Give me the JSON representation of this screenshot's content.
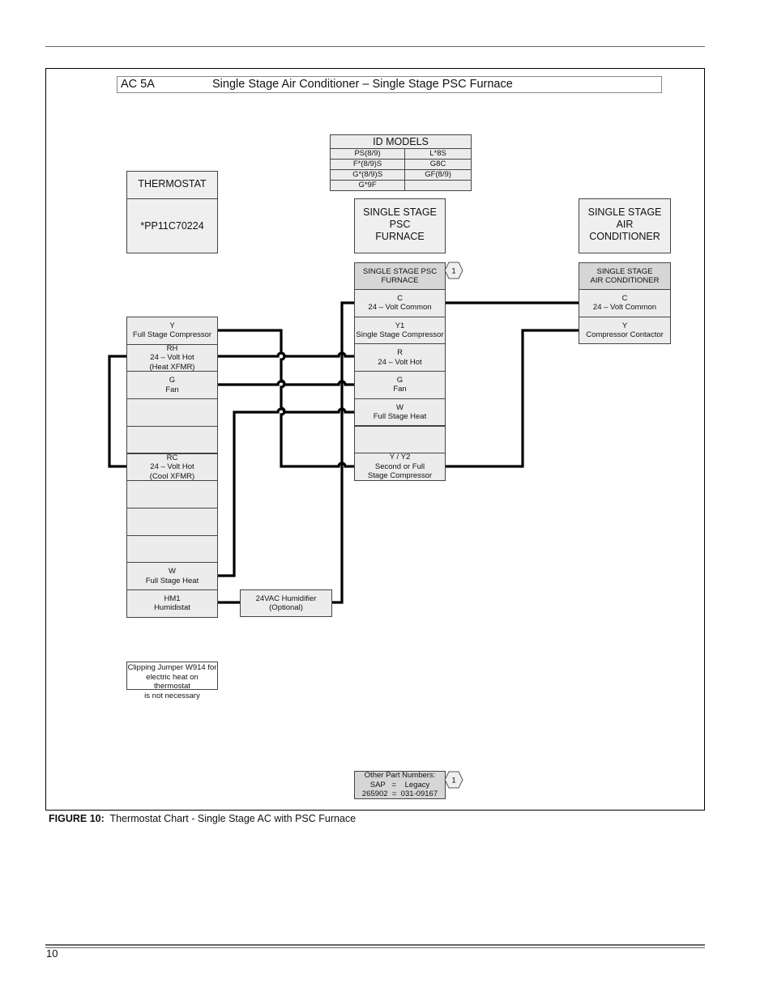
{
  "page": {
    "page_number": "10",
    "caption_label": "FIGURE 10:",
    "caption_text": "Thermostat Chart - Single Stage AC with PSC Furnace"
  },
  "diagram": {
    "code": "AC 5A",
    "title": "Single Stage Air Conditioner – Single Stage PSC Furnace",
    "id_models": {
      "header": "ID MODELS",
      "rows": [
        [
          "PS(8/9)",
          "L*8S"
        ],
        [
          "F*(8/9)S",
          "G8C"
        ],
        [
          "G*(8/9)S",
          "GF(8/9)"
        ],
        [
          "G*9F",
          ""
        ]
      ]
    },
    "thermostat": {
      "header": "THERMOSTAT",
      "model": "*PP11C70224",
      "terminals": [
        {
          "id": "Y",
          "lines": [
            "Y",
            "Full Stage Compressor"
          ]
        },
        {
          "id": "RH",
          "lines": [
            "RH",
            "24 – Volt Hot",
            "(Heat XFMR)"
          ]
        },
        {
          "id": "G",
          "lines": [
            "G",
            "Fan"
          ]
        },
        {
          "id": "blank1",
          "lines": []
        },
        {
          "id": "blank2",
          "lines": []
        },
        {
          "id": "RC",
          "lines": [
            "RC",
            "24 – Volt Hot",
            "(Cool XFMR)"
          ]
        },
        {
          "id": "blank3",
          "lines": []
        },
        {
          "id": "blank4",
          "lines": []
        },
        {
          "id": "blank5",
          "lines": []
        },
        {
          "id": "W",
          "lines": [
            "W",
            "Full Stage Heat"
          ]
        },
        {
          "id": "HM1",
          "lines": [
            "HM1",
            "Humidistat"
          ]
        }
      ]
    },
    "furnace": {
      "title_lines": [
        "SINGLE STAGE",
        "PSC",
        "FURNACE"
      ],
      "header_lines": [
        "SINGLE STAGE PSC",
        "FURNACE"
      ],
      "badge": "1",
      "terminals": [
        {
          "id": "C",
          "lines": [
            "C",
            "24 – Volt Common"
          ]
        },
        {
          "id": "Y1",
          "lines": [
            "Y1",
            "Single Stage Compressor"
          ]
        },
        {
          "id": "R",
          "lines": [
            "R",
            "24 – Volt Hot"
          ]
        },
        {
          "id": "G",
          "lines": [
            "G",
            "Fan"
          ]
        },
        {
          "id": "W",
          "lines": [
            "W",
            "Full Stage Heat"
          ]
        },
        {
          "id": "blank",
          "lines": []
        },
        {
          "id": "Y/Y2",
          "lines": [
            "Y / Y2",
            "Second or Full",
            "Stage Compressor"
          ]
        }
      ]
    },
    "air_conditioner": {
      "title_lines": [
        "SINGLE STAGE",
        "AIR",
        "CONDITIONER"
      ],
      "header_lines": [
        "SINGLE STAGE",
        "AIR CONDITIONER"
      ],
      "terminals": [
        {
          "id": "C",
          "lines": [
            "C",
            "24 – Volt Common"
          ]
        },
        {
          "id": "Y",
          "lines": [
            "Y",
            "Compressor Contactor"
          ]
        }
      ]
    },
    "humidifier": {
      "lines": [
        "24VAC Humidifier",
        "(Optional)"
      ]
    },
    "jumper_note": {
      "lines": [
        "Clipping Jumper W914 for",
        "electric heat on thermostat",
        "is not necessary"
      ]
    },
    "part_numbers": {
      "lines": [
        "Other Part Numbers:",
        "SAP   =    Legacy",
        "265902  =  031-09167"
      ],
      "badge": "1"
    },
    "connections": [
      {
        "from": "thermostat.Y",
        "to": "furnace.Y/Y2"
      },
      {
        "from": "thermostat.RH",
        "to": "furnace.R"
      },
      {
        "from": "thermostat.G",
        "to": "furnace.G"
      },
      {
        "from": "thermostat.W",
        "to": "furnace.W"
      },
      {
        "from": "thermostat.RH",
        "to": "thermostat.RC"
      },
      {
        "from": "thermostat.HM1",
        "to": "humidifier"
      },
      {
        "from": "humidifier",
        "to": "furnace.C"
      },
      {
        "from": "furnace.C",
        "to": "air_conditioner.C"
      },
      {
        "from": "furnace.Y/Y2",
        "to": "air_conditioner.Y"
      }
    ]
  }
}
